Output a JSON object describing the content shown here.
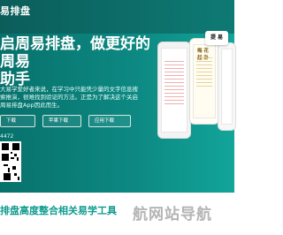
{
  "header": {
    "brand": "易排盘"
  },
  "hero": {
    "title_line1": "启周易排盘，做更好的周易",
    "title_line2": "助手",
    "description": "大易学爱好者来说，在学习中只能凭少量的文字信息搜索推演，很难找到验证的方法。正是为了解决这个关启周易排盘App因此而生。",
    "buttons": [
      "下载",
      "苹果下载",
      "应用下载"
    ],
    "phone_number": "4472"
  },
  "phones": {
    "phone_one_title": "",
    "phone_two_title": "梅 花 起 卦",
    "phone_three_title": ""
  },
  "gift": {
    "label": "提 易"
  },
  "footer": {
    "bottom_title": "排盘高度整合相关易学工具",
    "watermark": "航网站导航",
    "watermark_sub": ""
  }
}
